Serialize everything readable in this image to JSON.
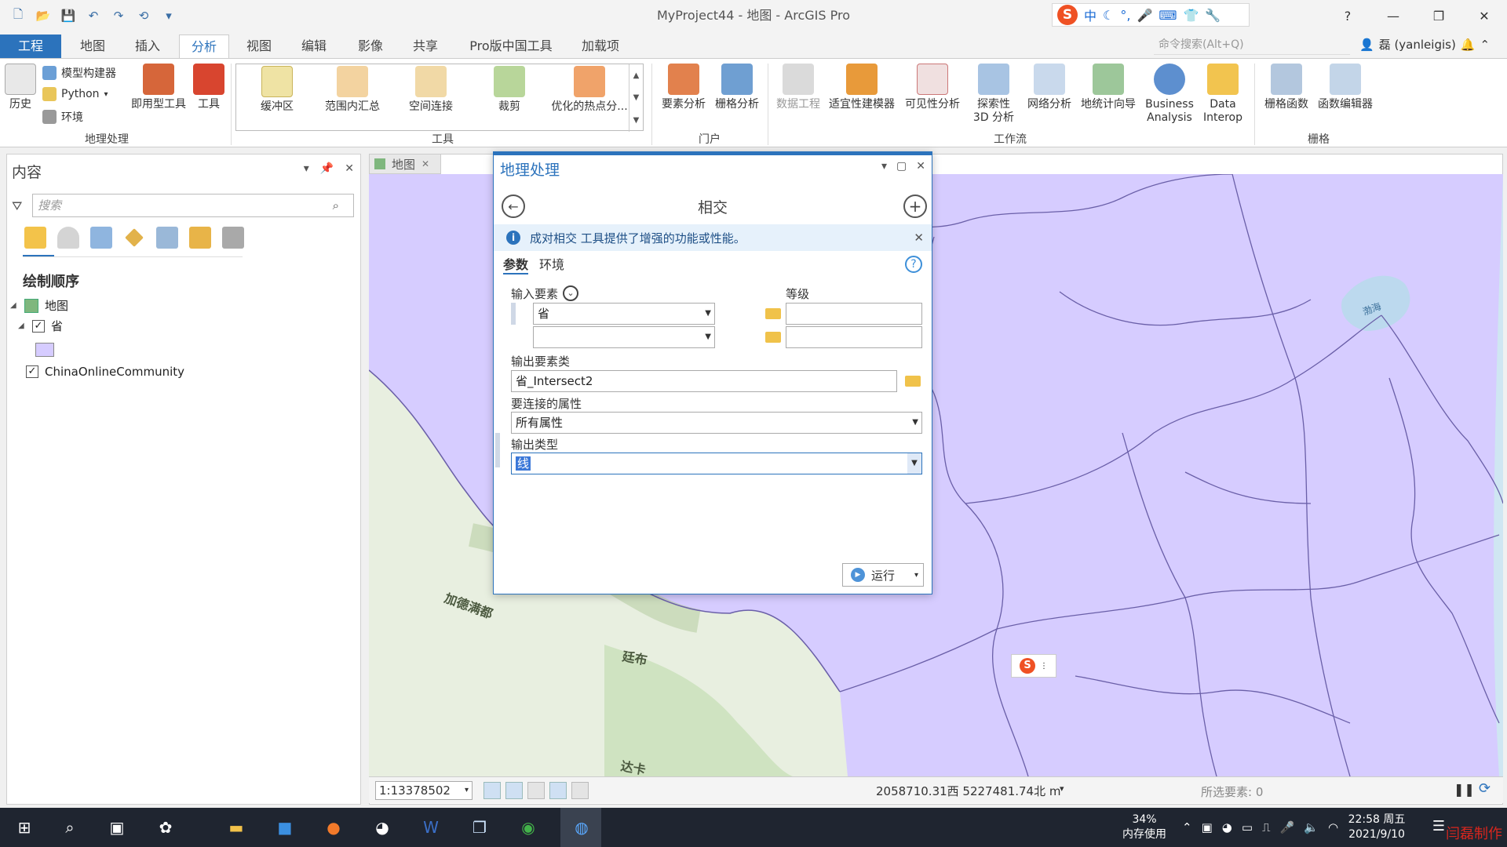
{
  "window": {
    "title": "MyProject44 - 地图 - ArcGIS Pro",
    "help": "?",
    "minimize": "—",
    "restore": "❐",
    "close": "✕"
  },
  "ime": {
    "logo": "S",
    "mode": "中"
  },
  "tabs": [
    "工程",
    "地图",
    "插入",
    "分析",
    "视图",
    "编辑",
    "影像",
    "共享",
    "Pro版中国工具",
    "加载项"
  ],
  "command_search": {
    "placeholder": "命令搜索(Alt+Q)"
  },
  "user": {
    "name": "磊 (yanleigis)"
  },
  "ribbon": {
    "groups": {
      "geoprocessing": "地理处理",
      "tools": "工具",
      "portal": "门户",
      "workflow": "工作流",
      "raster": "栅格"
    },
    "history": "历史",
    "model_builder": "模型构建器",
    "python": "Python",
    "environment": "环境",
    "ready_tools": "即用型工具",
    "toolbox": "工具",
    "gallery": [
      "缓冲区",
      "范围内汇总",
      "空间连接",
      "裁剪",
      "优化的热点分..."
    ],
    "portal_items": [
      "要素分析",
      "栅格分析"
    ],
    "workflow_items": [
      "数据工程",
      "适宜性建模器",
      "可见性分析",
      "探索性\n3D 分析",
      "网络分析",
      "地统计向导",
      "Business\nAnalysis",
      "Data\nInterop"
    ],
    "raster_items": [
      "栅格函数",
      "函数编辑器"
    ]
  },
  "contents": {
    "title": "内容",
    "search_placeholder": "搜索",
    "section": "绘制顺序",
    "map": "地图",
    "layer1": "省",
    "layer2": "ChinaOnlineCommunity"
  },
  "map": {
    "tab": "地图",
    "labels": {
      "bohai": "渤海",
      "himalaya": "加德满都",
      "thimphu": "廷布",
      "dhaka": "达卡"
    },
    "scale": "1:13378502",
    "coordinates": "2058710.31西 5227481.74北 m",
    "selected": "所选要素: 0"
  },
  "gp": {
    "title": "地理处理",
    "tool": "相交",
    "info": "成对相交 工具提供了增强的功能或性能。",
    "tab_params": "参数",
    "tab_env": "环境",
    "input_label": "输入要素",
    "rank_label": "等级",
    "input1": "省",
    "input2": "",
    "output_label": "输出要素类",
    "output_value": "省_Intersect2",
    "join_label": "要连接的属性",
    "join_value": "所有属性",
    "type_label": "输出类型",
    "type_value": "线",
    "run": "运行"
  },
  "taskbar": {
    "memory_pct": "34%",
    "memory_label": "内存使用",
    "time": "22:58 周五",
    "date": "2021/9/10",
    "watermark": "闫磊制作"
  },
  "colors": {
    "accent": "#2c73bc",
    "province_fill": "#d6ccff",
    "province_line": "#6a5fa8"
  }
}
